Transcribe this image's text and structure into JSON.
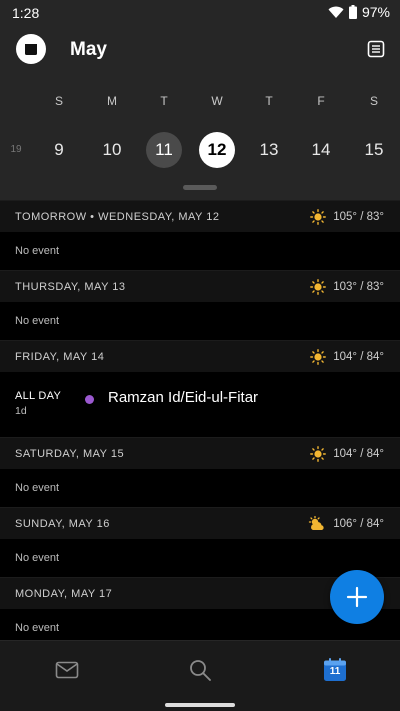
{
  "status": {
    "time": "1:28",
    "battery": "97%"
  },
  "header": {
    "month": "May"
  },
  "week": {
    "weekdays": [
      "S",
      "M",
      "T",
      "W",
      "T",
      "F",
      "S"
    ],
    "prev_date": "19",
    "dates": [
      "9",
      "10",
      "11",
      "12",
      "13",
      "14",
      "15"
    ]
  },
  "agenda": {
    "days": [
      {
        "title": "TOMORROW • WEDNESDAY, MAY 12",
        "weather_icon": "sun-icon",
        "temp": "105° / 83°",
        "body": "No event"
      },
      {
        "title": "THURSDAY, MAY 13",
        "weather_icon": "sun-icon",
        "temp": "103° / 83°",
        "body": "No event"
      },
      {
        "title": "FRIDAY, MAY 14",
        "weather_icon": "sun-icon",
        "temp": "104° / 84°",
        "event": {
          "time": "ALL DAY",
          "duration": "1d",
          "title": "Ramzan Id/Eid-ul-Fitar",
          "color": "#9b59d0"
        }
      },
      {
        "title": "SATURDAY, MAY 15",
        "weather_icon": "sun-icon",
        "temp": "104° / 84°",
        "body": "No event"
      },
      {
        "title": "SUNDAY, MAY 16",
        "weather_icon": "partly-cloudy-icon",
        "temp": "106° / 84°",
        "body": "No event"
      },
      {
        "title": "MONDAY, MAY 17",
        "weather_icon": "cloud-icon",
        "temp": "",
        "body": "No event"
      }
    ]
  },
  "colors": {
    "accent": "#0f7fe3",
    "sun": "#f2b632",
    "event_dot": "#9b59d0"
  },
  "nav": {
    "items": [
      "mail-icon",
      "search-icon",
      "calendar-icon"
    ],
    "calendar_day": "11"
  }
}
